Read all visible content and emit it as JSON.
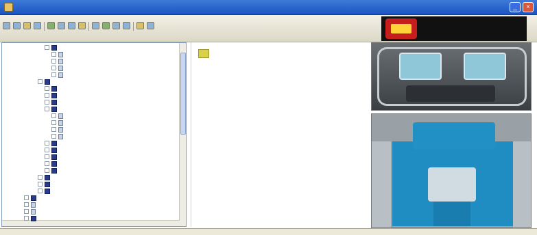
{
  "window": {
    "title": "",
    "controls": {
      "minimize": "_",
      "maximize": "□",
      "close": "×"
    }
  },
  "toolbar": {
    "label": ""
  },
  "logo": {
    "text": ""
  },
  "content": {
    "warning_title": "",
    "paragraphs": [
      "",
      "",
      "",
      "",
      "",
      "",
      "",
      ""
    ]
  },
  "status": {
    "left": "",
    "right": ""
  },
  "colors": {
    "titlebar": "#245edb",
    "accent": "#1f8cc2",
    "link": "#2b45b8"
  },
  "tree": {
    "rows": []
  }
}
